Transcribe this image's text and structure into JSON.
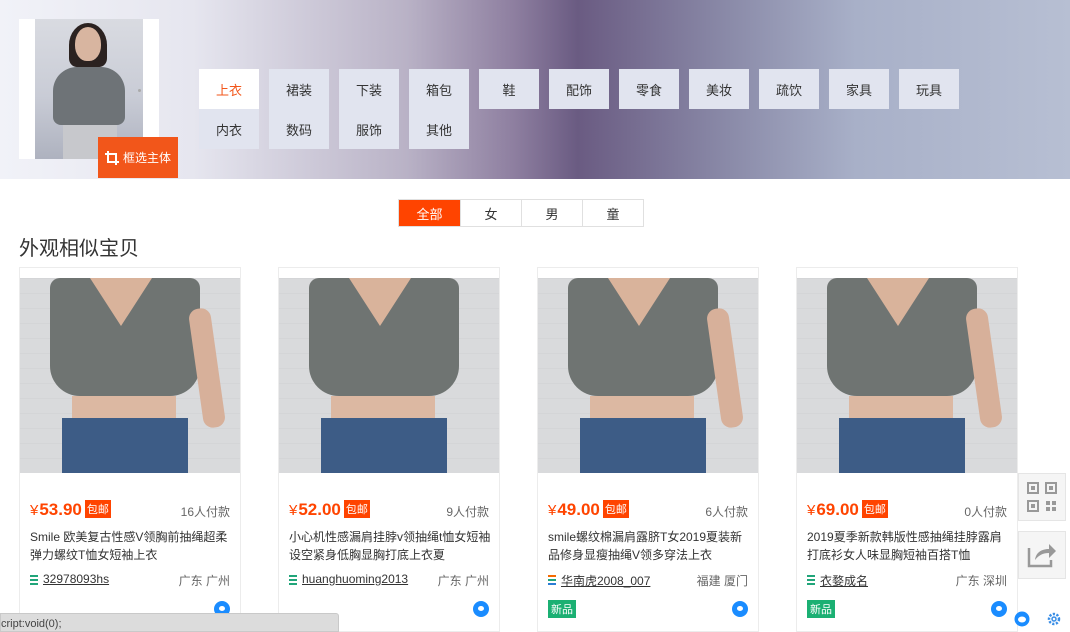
{
  "crop_button_label": "框选主体",
  "categories": [
    {
      "label": "上衣",
      "active": true
    },
    {
      "label": "裙装"
    },
    {
      "label": "下装"
    },
    {
      "label": "箱包"
    },
    {
      "label": "鞋"
    },
    {
      "label": "配饰"
    },
    {
      "label": "零食"
    },
    {
      "label": "美妆"
    },
    {
      "label": "疏饮"
    },
    {
      "label": "家具"
    },
    {
      "label": "玩具"
    },
    {
      "label": "内衣"
    },
    {
      "label": "数码"
    },
    {
      "label": "服饰"
    },
    {
      "label": "其他"
    }
  ],
  "filters": [
    {
      "label": "全部",
      "active": true
    },
    {
      "label": "女"
    },
    {
      "label": "男"
    },
    {
      "label": "童"
    }
  ],
  "section_title": "外观相似宝贝",
  "products": [
    {
      "currency": "¥",
      "price": "53.90",
      "shipping": "包邮",
      "paid": "16人付款",
      "title": "Smile 欧美复古性感V领胸前抽绳超柔弹力螺纹T恤女短袖上衣",
      "shop": "32978093hs",
      "location": "广东 广州",
      "badge": "",
      "shop_icon": "green"
    },
    {
      "currency": "¥",
      "price": "52.00",
      "shipping": "包邮",
      "paid": "9人付款",
      "title": "小心机性感漏肩挂脖v领抽绳t恤女短袖设空紧身低胸显胸打底上衣夏",
      "shop": "huanghuoming2013",
      "location": "广东 广州",
      "badge": "",
      "shop_icon": "green"
    },
    {
      "currency": "¥",
      "price": "49.00",
      "shipping": "包邮",
      "paid": "6人付款",
      "title": "smile螺纹棉漏肩露脐T女2019夏装新品修身显瘦抽绳V领多穿法上衣",
      "shop": "华南虎2008_007",
      "location": "福建 厦门",
      "badge": "新品",
      "shop_icon": "orange"
    },
    {
      "currency": "¥",
      "price": "69.00",
      "shipping": "包邮",
      "paid": "0人付款",
      "title": "2019夏季新款韩版性感抽绳挂脖露肩打底衫女人味显胸短袖百搭T恤",
      "shop": "衣婺成名",
      "location": "广东 深圳",
      "badge": "新品",
      "shop_icon": "green"
    }
  ],
  "status_text": "cript:void(0);",
  "colors": {
    "accent": "#ff4400",
    "new_badge": "#1bb073",
    "tab_bg": "#e1e4ef"
  }
}
